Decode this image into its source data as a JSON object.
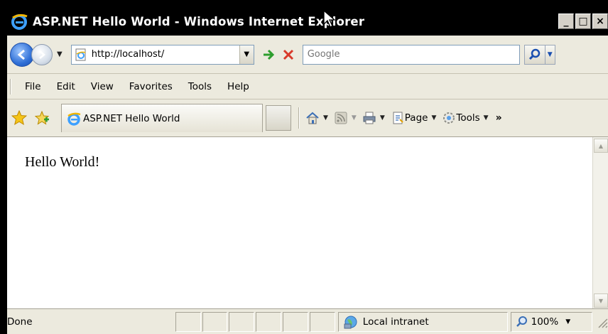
{
  "window": {
    "title": "ASP.NET Hello World - Windows Internet Explorer",
    "controls": {
      "minimize": "_",
      "maximize": "□",
      "close": "×"
    }
  },
  "address_bar": {
    "url": "http://localhost/"
  },
  "search": {
    "placeholder": "Google"
  },
  "menu": {
    "items": [
      "File",
      "Edit",
      "View",
      "Favorites",
      "Tools",
      "Help"
    ]
  },
  "tab": {
    "label": "ASP.NET Hello World"
  },
  "commands": {
    "page": "Page",
    "tools": "Tools",
    "more": "»"
  },
  "content": {
    "text": "Hello World!"
  },
  "status": {
    "text": "Done",
    "zone": "Local intranet",
    "zoom": "100%"
  },
  "colors": {
    "chrome": "#eceade",
    "titlebar": "#000000",
    "accent": "#2f6fd6"
  }
}
